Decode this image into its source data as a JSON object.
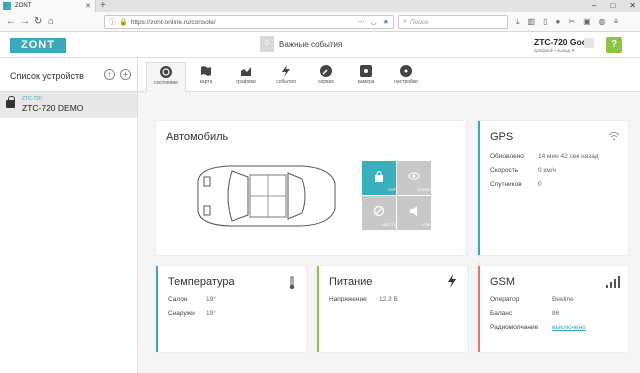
{
  "browser": {
    "tab_title": "ZONT",
    "url": "https://zont-online.ru/console/",
    "search_placeholder": "Поиск"
  },
  "header": {
    "logo": "ZONT",
    "events_count": "0",
    "events_label": "Важные события",
    "device_name": "ZTC-720 Good",
    "device_sub": "zpsdpack • выход Я"
  },
  "sidebar": {
    "title": "Список устройств",
    "devices": [
      {
        "model": "ZTC-720",
        "name": "ZTC-720 DEMO"
      }
    ]
  },
  "tabs": [
    {
      "label": "состояние",
      "icon": "status-icon",
      "active": true
    },
    {
      "label": "карта",
      "icon": "map-icon",
      "active": false
    },
    {
      "label": "графики",
      "icon": "chart-icon",
      "active": false
    },
    {
      "label": "события",
      "icon": "lightning-icon",
      "active": false
    },
    {
      "label": "сервис",
      "icon": "wrench-icon",
      "active": false
    },
    {
      "label": "камера",
      "icon": "camera-icon",
      "active": false
    },
    {
      "label": "настройки",
      "icon": "gear-icon",
      "active": false
    }
  ],
  "car_card": {
    "title": "Автомобиль",
    "tiles": [
      {
        "label": "ОХРАНА",
        "state": "on",
        "icon": "lock-icon"
      },
      {
        "label": "БЛОКИРОВКА",
        "state": "off",
        "icon": "eye-icon"
      },
      {
        "label": "АВТОЗАПУСК",
        "state": "off",
        "icon": "block-icon"
      },
      {
        "label": "СИРЕНА",
        "state": "off",
        "icon": "siren-icon"
      }
    ]
  },
  "gps": {
    "title": "GPS",
    "rows": [
      {
        "label": "Обновлено",
        "value": "14 мин 42 сек назад"
      },
      {
        "label": "Скорость",
        "value": "0 км/ч"
      },
      {
        "label": "Спутников",
        "value": "0"
      }
    ]
  },
  "temperature": {
    "title": "Температура",
    "rows": [
      {
        "label": "Салон",
        "value": "19°"
      },
      {
        "label": "Снаружи",
        "value": "19°"
      }
    ]
  },
  "power": {
    "title": "Питание",
    "rows": [
      {
        "label": "Напряжение",
        "value": "12.3 В"
      }
    ]
  },
  "gsm": {
    "title": "GSM",
    "rows": [
      {
        "label": "Оператор",
        "value": "Beeline"
      },
      {
        "label": "Баланс",
        "value": "86"
      },
      {
        "label": "Радиомолчание",
        "value": "выключено"
      }
    ]
  },
  "colors": {
    "accent": "#3aa9b8",
    "green": "#8cc63f",
    "red": "#e07a6e"
  }
}
